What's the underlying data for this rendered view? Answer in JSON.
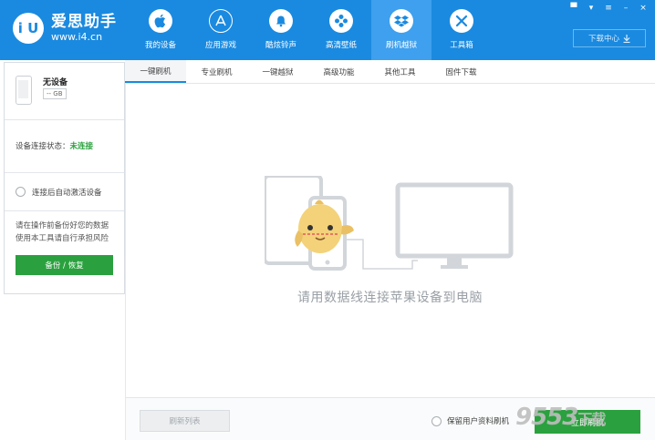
{
  "app": {
    "logo_badge": "i U",
    "title": "爱思助手",
    "url": "www.i4.cn"
  },
  "nav": [
    {
      "label": "我的设备",
      "icon": "apple-icon"
    },
    {
      "label": "应用游戏",
      "icon": "app-store-icon"
    },
    {
      "label": "酷炫铃声",
      "icon": "bell-icon"
    },
    {
      "label": "高清壁纸",
      "icon": "flower-icon"
    },
    {
      "label": "刷机越狱",
      "icon": "dropbox-icon",
      "active": true
    },
    {
      "label": "工具箱",
      "icon": "tools-icon"
    }
  ],
  "window_controls": [
    "▀",
    "▾",
    "≡",
    "–",
    "×"
  ],
  "download_center": "下载中心",
  "sidebar": {
    "device_name": "无设备",
    "capacity": "-- GB",
    "status_label": "设备连接状态：",
    "status_value": "未连接",
    "auto_activate": "连接后自动激活设备",
    "warning_line1": "请在操作前备份好您的数据",
    "warning_line2": "使用本工具请自行承担风险",
    "backup_button": "备份 / 恢复"
  },
  "tabs": [
    "一键刷机",
    "专业刷机",
    "一键越狱",
    "高级功能",
    "其他工具",
    "固件下载"
  ],
  "main": {
    "hint": "请用数据线连接苹果设备到电脑"
  },
  "bottom": {
    "refresh_button": "刷新列表",
    "keep_data": "保留用户资料刷机",
    "flash_button": "立即刷机"
  },
  "watermark": {
    "number": "9553",
    "text": "下载"
  },
  "colors": {
    "topbar": "#1a8ae0",
    "accent_green": "#2aa13e",
    "status_green": "#2aa13e"
  }
}
